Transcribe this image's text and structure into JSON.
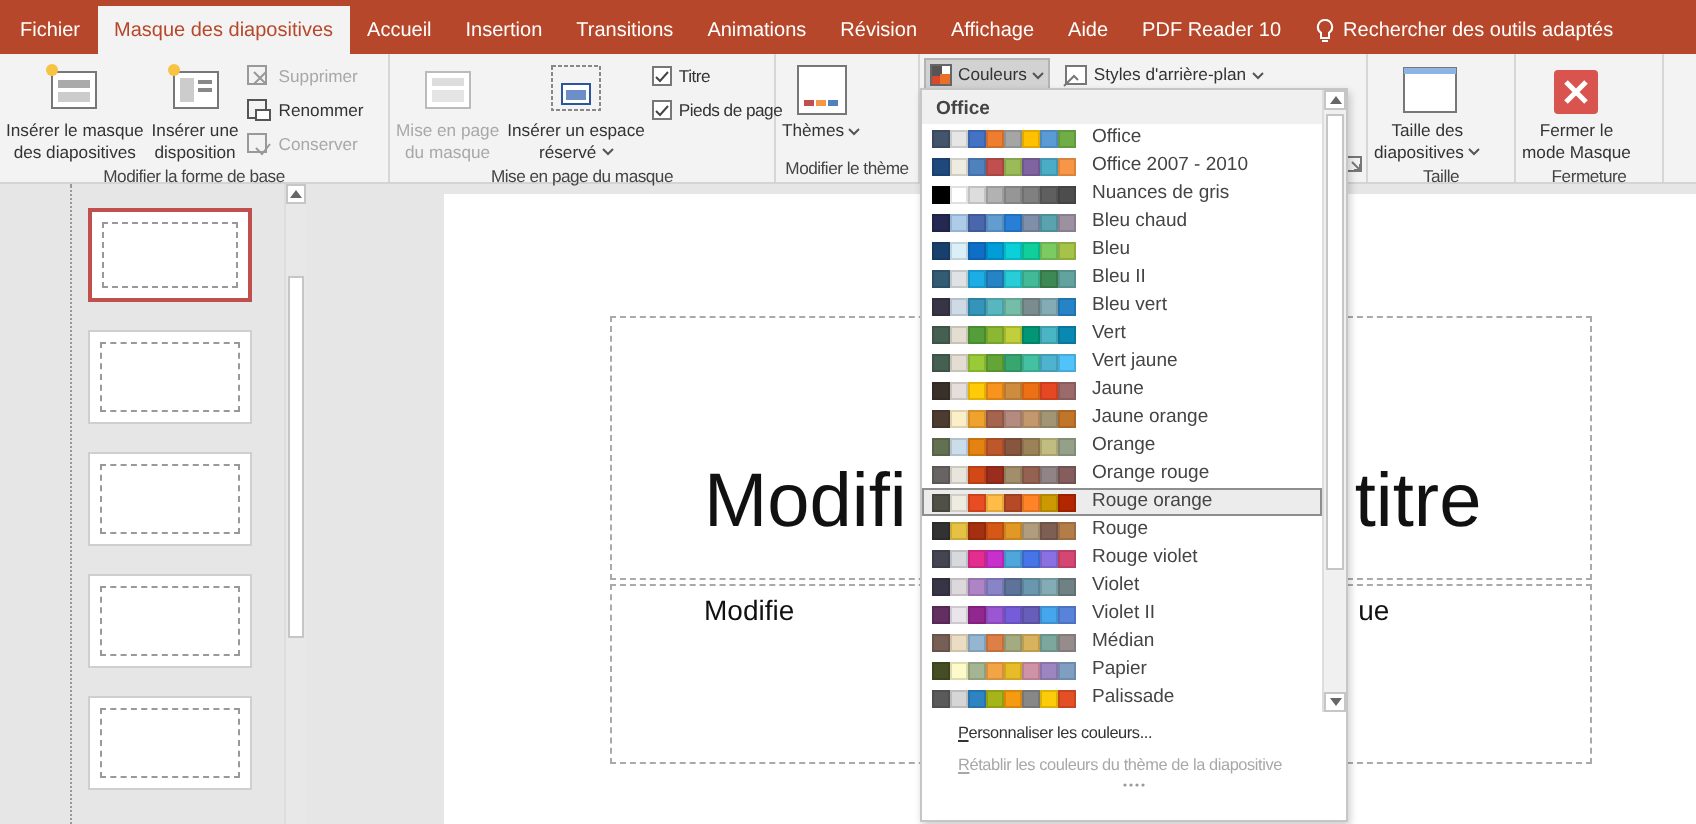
{
  "tabs": [
    {
      "label": "Fichier",
      "selected": false
    },
    {
      "label": "Masque des diapositives",
      "selected": true
    },
    {
      "label": "Accueil",
      "selected": false
    },
    {
      "label": "Insertion",
      "selected": false
    },
    {
      "label": "Transitions",
      "selected": false
    },
    {
      "label": "Animations",
      "selected": false
    },
    {
      "label": "Révision",
      "selected": false
    },
    {
      "label": "Affichage",
      "selected": false
    },
    {
      "label": "Aide",
      "selected": false
    },
    {
      "label": "PDF Reader 10",
      "selected": false
    }
  ],
  "tell_me": {
    "text": "Rechercher des outils adaptés"
  },
  "ribbon": {
    "groups": [
      {
        "label": "Modifier la forme de base",
        "items": [
          {
            "kind": "large",
            "lines": [
              "Insérer le masque",
              "des diapositives"
            ],
            "disabled": false,
            "menu": false
          },
          {
            "kind": "large",
            "lines": [
              "Insérer une",
              "disposition"
            ],
            "disabled": false,
            "menu": false
          },
          {
            "kind": "small",
            "label": "Supprimer",
            "disabled": true
          },
          {
            "kind": "small",
            "label": "Renommer",
            "disabled": false
          },
          {
            "kind": "small",
            "label": "Conserver",
            "disabled": true
          }
        ]
      },
      {
        "label": "Mise en page du masque",
        "items": [
          {
            "kind": "large",
            "lines": [
              "Mise en page",
              "du masque"
            ],
            "disabled": true,
            "menu": false
          },
          {
            "kind": "large",
            "lines": [
              "Insérer un espace",
              "réservé"
            ],
            "disabled": false,
            "menu": true
          },
          {
            "kind": "check",
            "label": "Titre",
            "checked": true
          },
          {
            "kind": "check",
            "label": "Pieds de page",
            "checked": true
          }
        ]
      },
      {
        "label": "Modifier le thème",
        "items": [
          {
            "kind": "large",
            "lines": [
              "Thèmes"
            ],
            "disabled": false,
            "menu": true
          }
        ]
      },
      {
        "items": [
          {
            "kind": "menu",
            "label": "Couleurs",
            "pressed": true
          },
          {
            "kind": "menu",
            "label": "Styles d'arrière-plan",
            "pressed": false
          }
        ]
      },
      {
        "label": "Taille",
        "items": [
          {
            "kind": "large",
            "lines": [
              "Taille des",
              "diapositives"
            ],
            "disabled": false,
            "menu": true
          }
        ]
      },
      {
        "label": "Fermeture",
        "items": [
          {
            "kind": "large",
            "lines": [
              "Fermer le",
              "mode Masque"
            ],
            "disabled": false,
            "menu": false
          }
        ]
      }
    ]
  },
  "thumbnails": [
    {
      "selected": true
    },
    {
      "selected": false
    },
    {
      "selected": false
    },
    {
      "selected": false
    },
    {
      "selected": false
    }
  ],
  "slide": {
    "title_left": "Modifi",
    "title_right": "titre",
    "subtitle_left": "Modifie",
    "subtitle_right": "ue"
  },
  "colors_menu": {
    "header": "Office",
    "palettes": [
      {
        "name": "Office",
        "selected": false,
        "swatches": [
          {
            "color": "#44546a"
          },
          {
            "color": "#e7e6e6"
          },
          {
            "color": "#4472c4"
          },
          {
            "color": "#ed7d31"
          },
          {
            "color": "#a5a5a5"
          },
          {
            "color": "#ffc000"
          },
          {
            "color": "#5b9bd5"
          },
          {
            "color": "#70ad47"
          }
        ]
      },
      {
        "name": "Office 2007 - 2010",
        "selected": false,
        "swatches": [
          {
            "color": "#1f497d"
          },
          {
            "color": "#eeece1"
          },
          {
            "color": "#4f81bd"
          },
          {
            "color": "#c0504d"
          },
          {
            "color": "#9bbb59"
          },
          {
            "color": "#8064a2"
          },
          {
            "color": "#4bacc6"
          },
          {
            "color": "#f79646"
          }
        ]
      },
      {
        "name": "Nuances de gris",
        "selected": false,
        "swatches": [
          {
            "color": "#000000"
          },
          {
            "color": "#ffffff"
          },
          {
            "color": "#dddddd"
          },
          {
            "color": "#b2b2b2"
          },
          {
            "color": "#969696"
          },
          {
            "color": "#808080"
          },
          {
            "color": "#5f5f5f"
          },
          {
            "color": "#4d4d4d"
          }
        ]
      },
      {
        "name": "Bleu chaud",
        "selected": false,
        "swatches": [
          {
            "color": "#242852"
          },
          {
            "color": "#acccea"
          },
          {
            "color": "#4a66ac"
          },
          {
            "color": "#629dd1"
          },
          {
            "color": "#297fd5"
          },
          {
            "color": "#7f8fa9"
          },
          {
            "color": "#5aa2ae"
          },
          {
            "color": "#9d90a0"
          }
        ]
      },
      {
        "name": "Bleu",
        "selected": false,
        "swatches": [
          {
            "color": "#17406d"
          },
          {
            "color": "#dbeff9"
          },
          {
            "color": "#0f6fc6"
          },
          {
            "color": "#009dd9"
          },
          {
            "color": "#0bd0d9"
          },
          {
            "color": "#10cf9b"
          },
          {
            "color": "#7cca62"
          },
          {
            "color": "#a5c249"
          }
        ]
      },
      {
        "name": "Bleu II",
        "selected": false,
        "swatches": [
          {
            "color": "#335b74"
          },
          {
            "color": "#dfe3e5"
          },
          {
            "color": "#1cade4"
          },
          {
            "color": "#2683c6"
          },
          {
            "color": "#27ced7"
          },
          {
            "color": "#42ba97"
          },
          {
            "color": "#3e8853"
          },
          {
            "color": "#62a39f"
          }
        ]
      },
      {
        "name": "Bleu vert",
        "selected": false,
        "swatches": [
          {
            "color": "#373545"
          },
          {
            "color": "#cedbe6"
          },
          {
            "color": "#3494ba"
          },
          {
            "color": "#58b6c0"
          },
          {
            "color": "#75bda7"
          },
          {
            "color": "#7a8c8e"
          },
          {
            "color": "#84acb6"
          },
          {
            "color": "#2683c6"
          }
        ]
      },
      {
        "name": "Vert",
        "selected": false,
        "swatches": [
          {
            "color": "#455f51"
          },
          {
            "color": "#e3ded1"
          },
          {
            "color": "#549e39"
          },
          {
            "color": "#8ab833"
          },
          {
            "color": "#c0cf3a"
          },
          {
            "color": "#029676"
          },
          {
            "color": "#4ab5c4"
          },
          {
            "color": "#0989b1"
          }
        ]
      },
      {
        "name": "Vert jaune",
        "selected": false,
        "swatches": [
          {
            "color": "#455f51"
          },
          {
            "color": "#e3ded1"
          },
          {
            "color": "#99cb38"
          },
          {
            "color": "#63a537"
          },
          {
            "color": "#37a76f"
          },
          {
            "color": "#44c1a3"
          },
          {
            "color": "#4eb3cf"
          },
          {
            "color": "#51c3f9"
          }
        ]
      },
      {
        "name": "Jaune",
        "selected": false,
        "swatches": [
          {
            "color": "#39302a"
          },
          {
            "color": "#e5dedb"
          },
          {
            "color": "#ffca08"
          },
          {
            "color": "#f8931d"
          },
          {
            "color": "#ce8d3e"
          },
          {
            "color": "#ec7016"
          },
          {
            "color": "#e64823"
          },
          {
            "color": "#9c6a6a"
          }
        ]
      },
      {
        "name": "Jaune orange",
        "selected": false,
        "swatches": [
          {
            "color": "#4e3b30"
          },
          {
            "color": "#fbeec9"
          },
          {
            "color": "#f0a22e"
          },
          {
            "color": "#a5644e"
          },
          {
            "color": "#b58b80"
          },
          {
            "color": "#c3986d"
          },
          {
            "color": "#a19574"
          },
          {
            "color": "#c17529"
          }
        ]
      },
      {
        "name": "Orange",
        "selected": false,
        "swatches": [
          {
            "color": "#637052"
          },
          {
            "color": "#ccddea"
          },
          {
            "color": "#e48312"
          },
          {
            "color": "#bd582c"
          },
          {
            "color": "#865640"
          },
          {
            "color": "#9b8357"
          },
          {
            "color": "#c2bc80"
          },
          {
            "color": "#94a088"
          }
        ]
      },
      {
        "name": "Orange rouge",
        "selected": false,
        "swatches": [
          {
            "color": "#696464"
          },
          {
            "color": "#e9e5dc"
          },
          {
            "color": "#d34817"
          },
          {
            "color": "#9b2d1f"
          },
          {
            "color": "#a28e6a"
          },
          {
            "color": "#956251"
          },
          {
            "color": "#918485"
          },
          {
            "color": "#855d5d"
          }
        ]
      },
      {
        "name": "Rouge orange",
        "selected": true,
        "swatches": [
          {
            "color": "#505046"
          },
          {
            "color": "#eeece1"
          },
          {
            "color": "#e84c22"
          },
          {
            "color": "#ffbd47"
          },
          {
            "color": "#b64926"
          },
          {
            "color": "#ff8427"
          },
          {
            "color": "#cc9900"
          },
          {
            "color": "#b22600"
          }
        ]
      },
      {
        "name": "Rouge",
        "selected": false,
        "swatches": [
          {
            "color": "#323232"
          },
          {
            "color": "#e5c243"
          },
          {
            "color": "#a5300f"
          },
          {
            "color": "#d55816"
          },
          {
            "color": "#e19825"
          },
          {
            "color": "#b19c7d"
          },
          {
            "color": "#7f5f52"
          },
          {
            "color": "#b27d49"
          }
        ]
      },
      {
        "name": "Rouge violet",
        "selected": false,
        "swatches": [
          {
            "color": "#454551"
          },
          {
            "color": "#d8d9dc"
          },
          {
            "color": "#e32d91"
          },
          {
            "color": "#c830cc"
          },
          {
            "color": "#4ea6dc"
          },
          {
            "color": "#4775e7"
          },
          {
            "color": "#8971e1"
          },
          {
            "color": "#d54773"
          }
        ]
      },
      {
        "name": "Violet",
        "selected": false,
        "swatches": [
          {
            "color": "#373545"
          },
          {
            "color": "#dcd8dc"
          },
          {
            "color": "#ad84c6"
          },
          {
            "color": "#8784c7"
          },
          {
            "color": "#5d739a"
          },
          {
            "color": "#6997af"
          },
          {
            "color": "#84acb6"
          },
          {
            "color": "#6f8183"
          }
        ]
      },
      {
        "name": "Violet II",
        "selected": false,
        "swatches": [
          {
            "color": "#632e62"
          },
          {
            "color": "#eae5eb"
          },
          {
            "color": "#92278f"
          },
          {
            "color": "#9b57d3"
          },
          {
            "color": "#755dd9"
          },
          {
            "color": "#665eb8"
          },
          {
            "color": "#45a5ed"
          },
          {
            "color": "#5982db"
          }
        ]
      },
      {
        "name": "Médian",
        "selected": false,
        "swatches": [
          {
            "color": "#775f55"
          },
          {
            "color": "#ebddc3"
          },
          {
            "color": "#94b6d2"
          },
          {
            "color": "#dd8047"
          },
          {
            "color": "#a5ab81"
          },
          {
            "color": "#d8b25c"
          },
          {
            "color": "#7ba79d"
          },
          {
            "color": "#968c8c"
          }
        ]
      },
      {
        "name": "Papier",
        "selected": false,
        "swatches": [
          {
            "color": "#444d26"
          },
          {
            "color": "#fefac9"
          },
          {
            "color": "#a5b592"
          },
          {
            "color": "#f3a447"
          },
          {
            "color": "#e7bc29"
          },
          {
            "color": "#d092a7"
          },
          {
            "color": "#9c85c0"
          },
          {
            "color": "#809ec2"
          }
        ]
      },
      {
        "name": "Palissade",
        "selected": false,
        "swatches": [
          {
            "color": "#5a5a5a"
          },
          {
            "color": "#d6d6d6"
          },
          {
            "color": "#2e83c3"
          },
          {
            "color": "#a5b419"
          },
          {
            "color": "#f59a11"
          },
          {
            "color": "#878787"
          },
          {
            "color": "#fccb09"
          },
          {
            "color": "#e35026"
          }
        ]
      }
    ],
    "actions": [
      {
        "label": "Personnaliser les couleurs...",
        "disabled": false
      },
      {
        "label": "Rétablir les couleurs du thème de la diapositive",
        "disabled": true
      }
    ]
  }
}
